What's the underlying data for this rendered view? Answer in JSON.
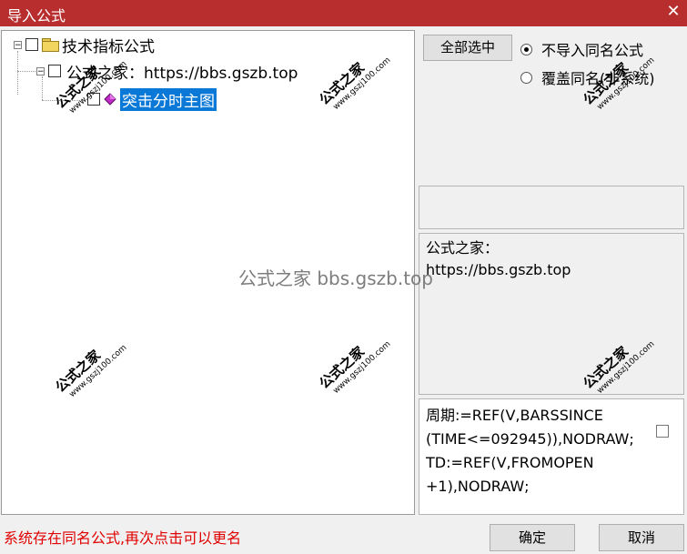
{
  "window": {
    "title": "导入公式"
  },
  "tree": {
    "root_label": "技术指标公式",
    "child_label": "公式之家：https://bbs.gszb.top",
    "leaf_label": "突击分时主图"
  },
  "buttons": {
    "select_all": "全部选中",
    "ok": "确定",
    "cancel": "取消"
  },
  "options": {
    "no_import": "不导入同名公式",
    "overwrite": "覆盖同名(非系统)",
    "selected": "no_import"
  },
  "info_box": {
    "text": "公式之家：\nhttps://bbs.gszb.top"
  },
  "code_box": {
    "text": "周期:=REF(V,BARSSINCE\n(TIME<=092945)),NODRAW;\nTD:=REF(V,FROMOPEN\n+1),NODRAW;"
  },
  "status": {
    "message": "系统存在同名公式,再次点击可以更名"
  },
  "watermark": {
    "main": "公式之家",
    "sub": "www.gszj100.com",
    "center": "公式之家 bbs.gszb.top"
  },
  "colors": {
    "titlebar": "#b82d2e",
    "selection": "#0a78d7",
    "status": "#e00000"
  }
}
